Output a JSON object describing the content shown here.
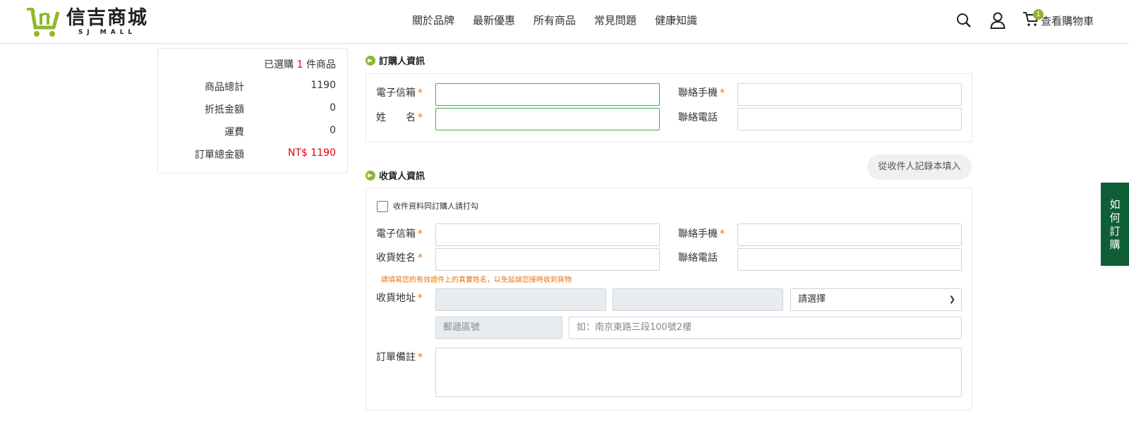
{
  "brand": {
    "name_zh": "信吉商城",
    "name_en": "SJ MALL",
    "color": "#8cb92d"
  },
  "nav": [
    "關於品牌",
    "最新優惠",
    "所有商品",
    "常見問題",
    "健康知識"
  ],
  "header_tools": {
    "cart_count": "1",
    "cart_label": "查看購物車",
    "icons": [
      "search-icon",
      "user-icon",
      "cart-icon"
    ]
  },
  "summary": {
    "selected_prefix": "已選購 ",
    "selected_count": "1",
    "selected_suffix": " 件商品",
    "rows": [
      {
        "label": "商品總計",
        "value": "1190"
      },
      {
        "label": "折抵金額",
        "value": "0"
      },
      {
        "label": "運費",
        "value": "0"
      },
      {
        "label": "訂單總金額",
        "value": "NT$ 1190"
      }
    ]
  },
  "orderer": {
    "title": "訂購人資訊",
    "email_label": "電子信箱",
    "mobile_label": "聯絡手機",
    "name_label": "姓　　名",
    "phone_label": "聯絡電話",
    "required_mark": "*"
  },
  "receiver": {
    "title": "收貨人資訊",
    "record_button": "從收件人記錄本填入",
    "same_as_orderer": "收件資料同訂購人請打勾",
    "email_label": "電子信箱",
    "mobile_label": "聯絡手機",
    "name_label": "收貨姓名",
    "phone_label": "聯絡電話",
    "name_hint": "請填寫您的有效證件上的真實姓名，以免延誤您接時收到貨物",
    "address_label": "收貨地址",
    "select_placeholder": "請選擇",
    "zip_placeholder": "郵遞區號",
    "address_placeholder": "如：南京東路三段100號2樓",
    "note_label": "訂單備註",
    "required_mark": "*"
  },
  "side_tab": "如何訂購"
}
